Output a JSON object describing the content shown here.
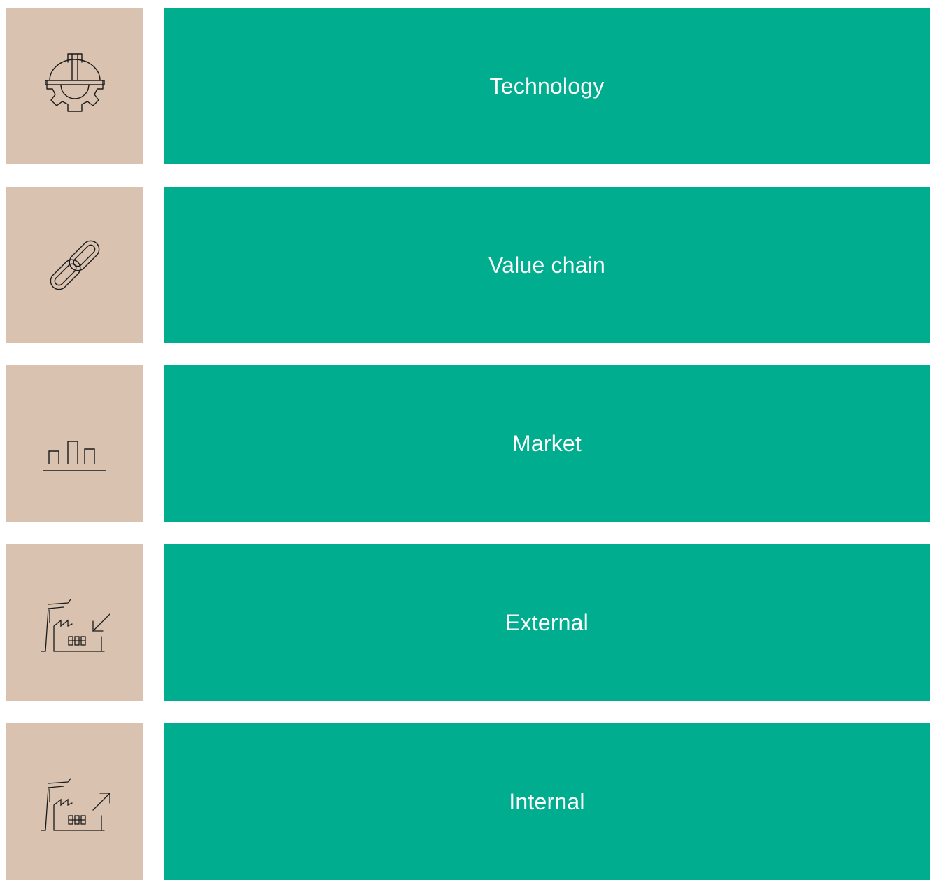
{
  "colors": {
    "icon_bg": "#d9c3b0",
    "label_bg": "#00ae8f",
    "label_text": "#ffffff",
    "icon_stroke": "#1a1a1a"
  },
  "items": [
    {
      "label": "Technology",
      "icon": "hardhat-gear-icon"
    },
    {
      "label": "Value chain",
      "icon": "chain-link-icon"
    },
    {
      "label": "Market",
      "icon": "bar-chart-icon"
    },
    {
      "label": "External",
      "icon": "factory-arrow-in-icon"
    },
    {
      "label": "Internal",
      "icon": "factory-arrow-out-icon"
    }
  ]
}
